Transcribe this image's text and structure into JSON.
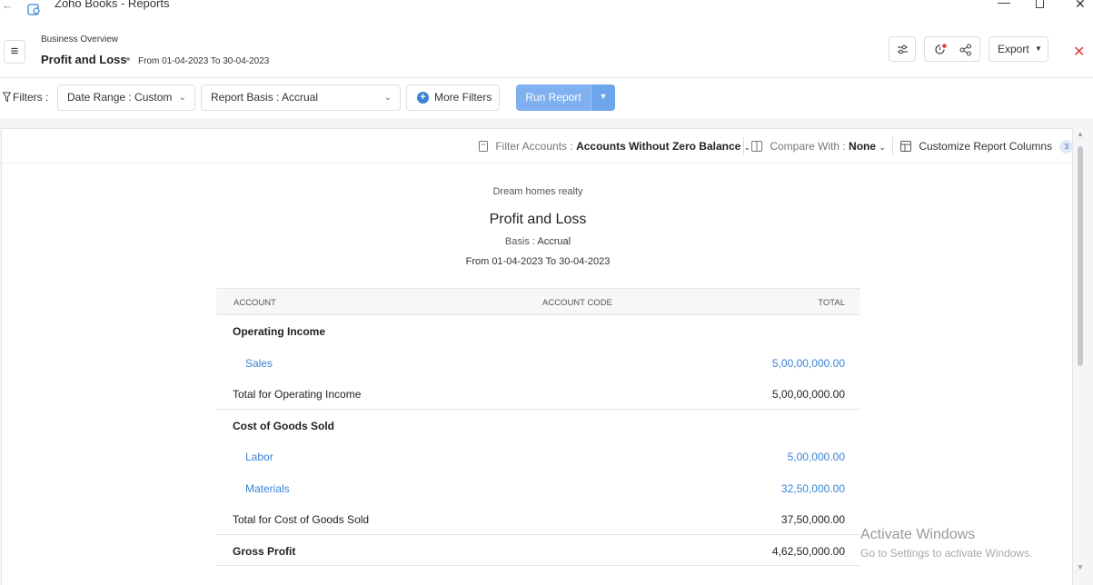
{
  "window": {
    "title": "Zoho Books - Reports",
    "minimize": "—",
    "close": "✕",
    "back": "←"
  },
  "header": {
    "breadcrumb": "Business Overview",
    "title": "Profit and Loss",
    "date_range": "From 01-04-2023 To 30-04-2023",
    "export_label": "Export",
    "close": "✕"
  },
  "filters": {
    "label": "Filters :",
    "date_range": "Date Range : Custom",
    "report_basis": "Report Basis : Accrual",
    "more_filters": "More Filters",
    "run_report": "Run Report"
  },
  "toolbar": {
    "filter_accounts_label": "Filter Accounts :",
    "filter_accounts_value": "Accounts Without Zero Balance",
    "compare_label": "Compare With :",
    "compare_value": "None",
    "customize_label": "Customize Report Columns",
    "customize_count": "3"
  },
  "report": {
    "company": "Dream homes realty",
    "title": "Profit and Loss",
    "basis_label": "Basis :",
    "basis_value": "Accrual",
    "period": "From 01-04-2023 To 30-04-2023",
    "columns": {
      "account": "ACCOUNT",
      "account_code": "ACCOUNT CODE",
      "total": "TOTAL"
    },
    "rows": [
      {
        "account": "Operating Income",
        "total": ""
      },
      {
        "account": "Sales",
        "total": "5,00,00,000.00"
      },
      {
        "account": "Total for Operating Income",
        "total": "5,00,00,000.00"
      },
      {
        "account": "Cost of Goods Sold",
        "total": ""
      },
      {
        "account": "Labor",
        "total": "5,00,000.00"
      },
      {
        "account": "Materials",
        "total": "32,50,000.00"
      },
      {
        "account": "Total for Cost of Goods Sold",
        "total": "37,50,000.00"
      },
      {
        "account": "Gross Profit",
        "total": "4,62,50,000.00"
      }
    ]
  },
  "watermark": {
    "title": "Activate Windows",
    "subtitle": "Go to Settings to activate Windows."
  },
  "colors": {
    "link": "#3b82d6",
    "run_button": "#7fb0ef",
    "close_red": "#e23d3d"
  }
}
